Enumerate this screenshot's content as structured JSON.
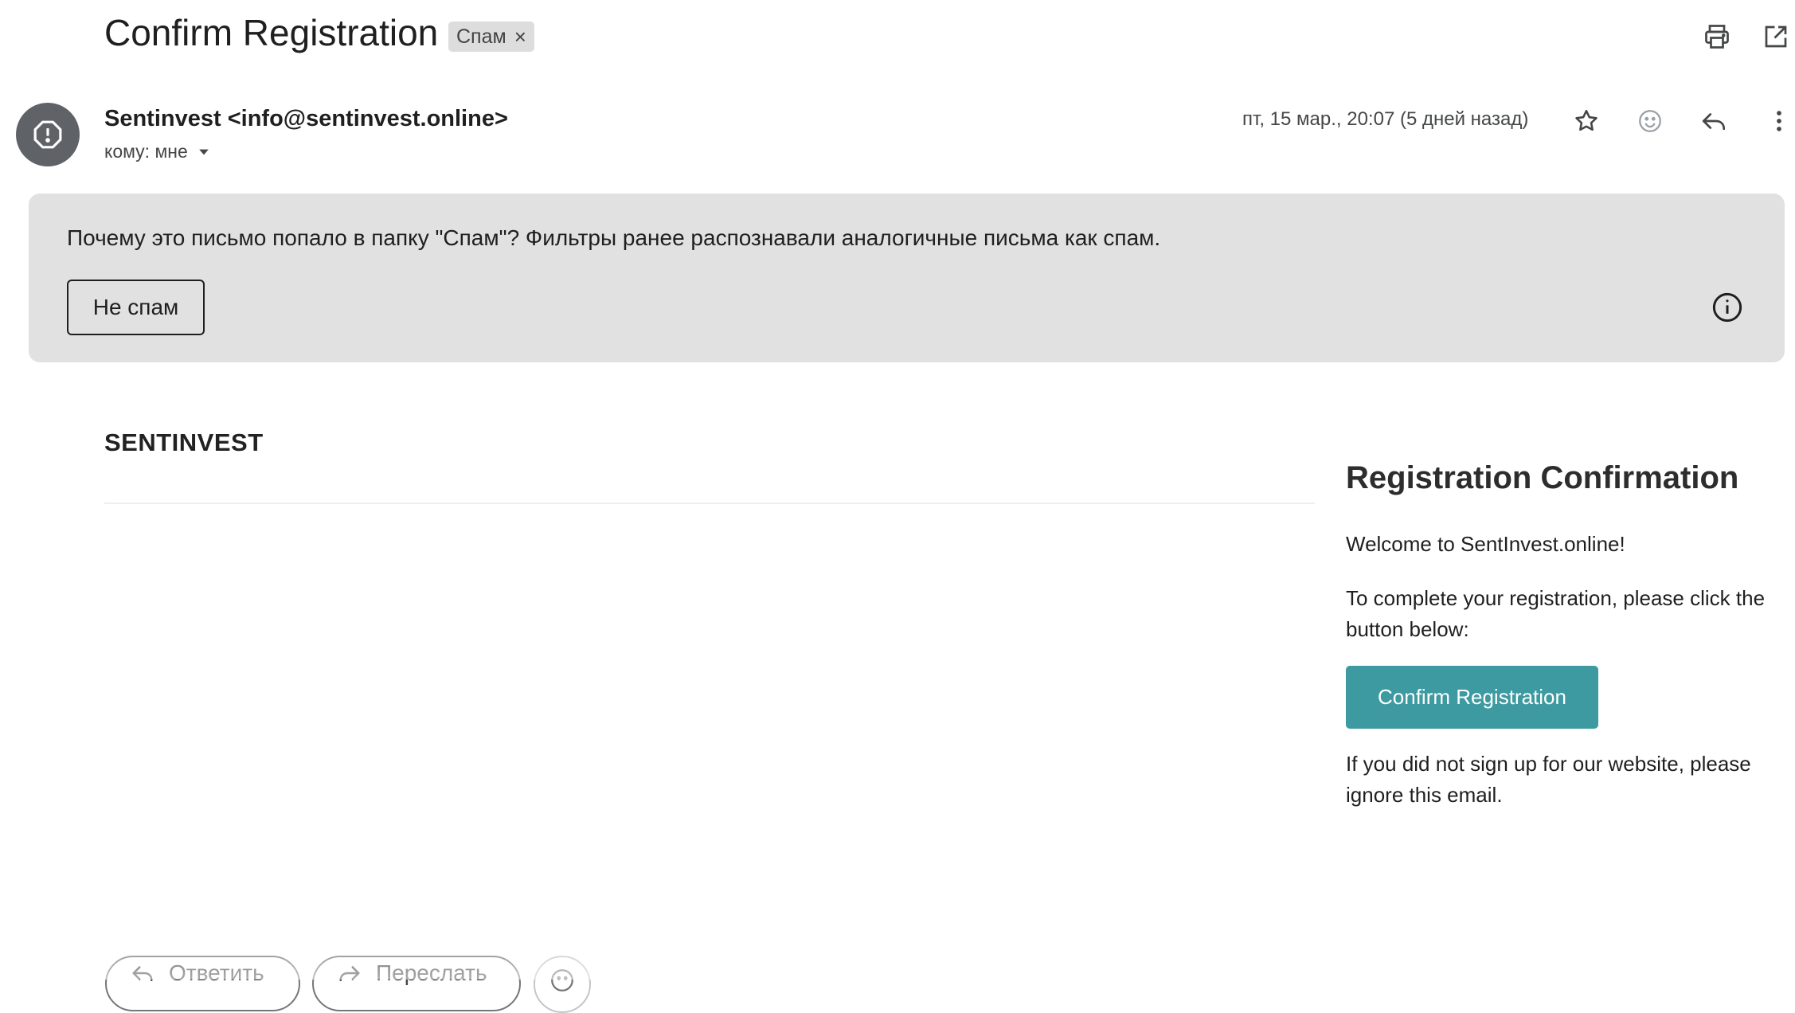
{
  "email": {
    "subject": "Confirm Registration",
    "label_chip": "Спам",
    "label_chip_remove": "×",
    "sender": "Sentinvest <info@sentinvest.online>",
    "recipient": "кому: мне",
    "date": "пт, 15 мар., 20:07 (5 дней назад)"
  },
  "spam_banner": {
    "heading": "Почему это письмо попало в папку \"Спам\"?",
    "explanation": " Фильтры ранее распознавали аналогичные письма как спам.",
    "not_spam_button": "Не спам"
  },
  "body": {
    "brand": "SENTINVEST",
    "title": "Registration Confirmation",
    "welcome": "Welcome to SentInvest.online!",
    "instruction": "To complete your registration, please click the button below:",
    "confirm_button": "Confirm Registration",
    "ignore_note": "If you did not sign up for our website, please ignore this email."
  },
  "footer": {
    "reply_button": "Ответить",
    "forward_button": "Переслать"
  },
  "icons": {
    "header": [
      "print-icon",
      "open-in-new-window-icon"
    ],
    "actions": [
      "star-icon",
      "emoji-icon",
      "reply-icon",
      "more-vert-icon"
    ],
    "avatar": "spam-warning-icon",
    "banner": "info-icon"
  },
  "colors": {
    "banner_bg": "#e1e1e1",
    "confirm_button_bg": "#3d9aa0",
    "avatar_bg": "#5f6368",
    "chip_bg": "#dddddd"
  }
}
